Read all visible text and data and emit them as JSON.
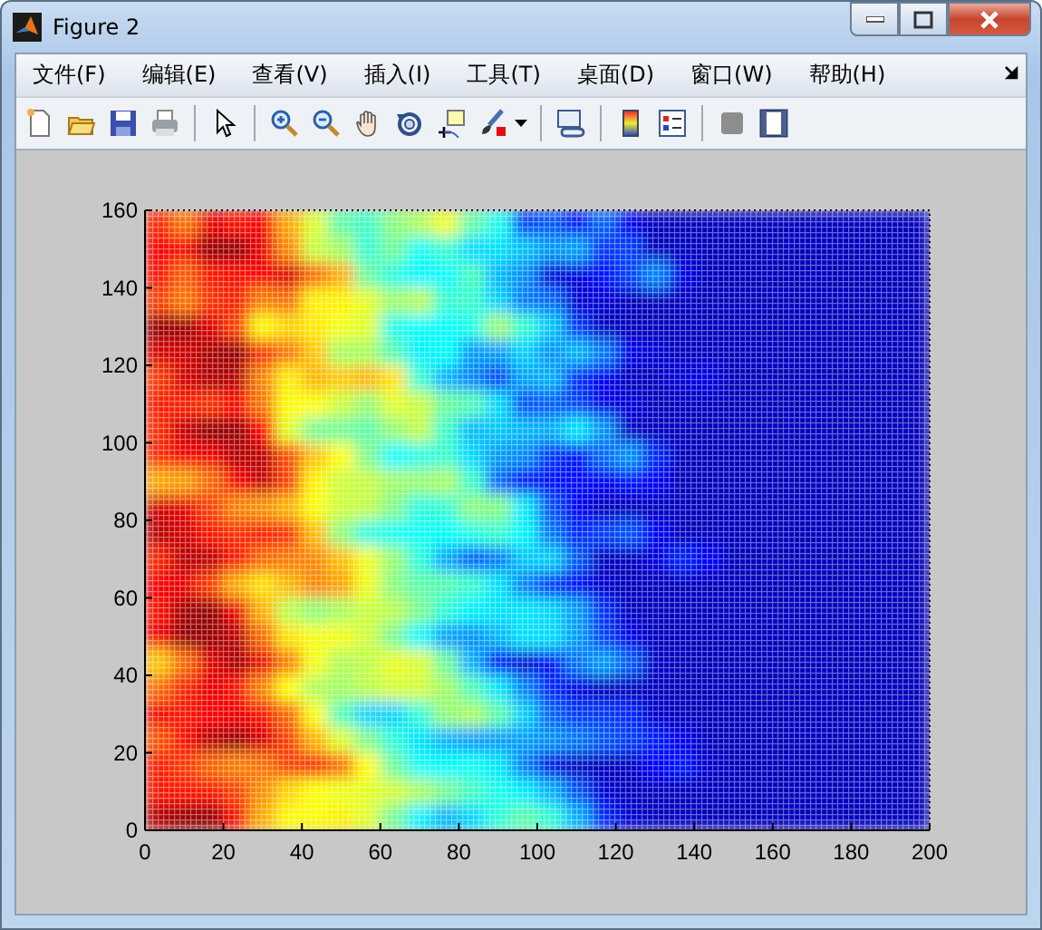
{
  "window": {
    "title": "Figure 2"
  },
  "menu": [
    {
      "label": "文件(F)"
    },
    {
      "label": "编辑(E)"
    },
    {
      "label": "查看(V)"
    },
    {
      "label": "插入(I)"
    },
    {
      "label": "工具(T)"
    },
    {
      "label": "桌面(D)"
    },
    {
      "label": "窗口(W)"
    },
    {
      "label": "帮助(H)"
    }
  ],
  "plot": {
    "xticks": [
      "0",
      "20",
      "40",
      "60",
      "80",
      "100",
      "120",
      "140",
      "160",
      "180",
      "200"
    ],
    "yticks": [
      "160",
      "140",
      "120",
      "100",
      "80",
      "60",
      "40",
      "20",
      "0"
    ]
  }
}
